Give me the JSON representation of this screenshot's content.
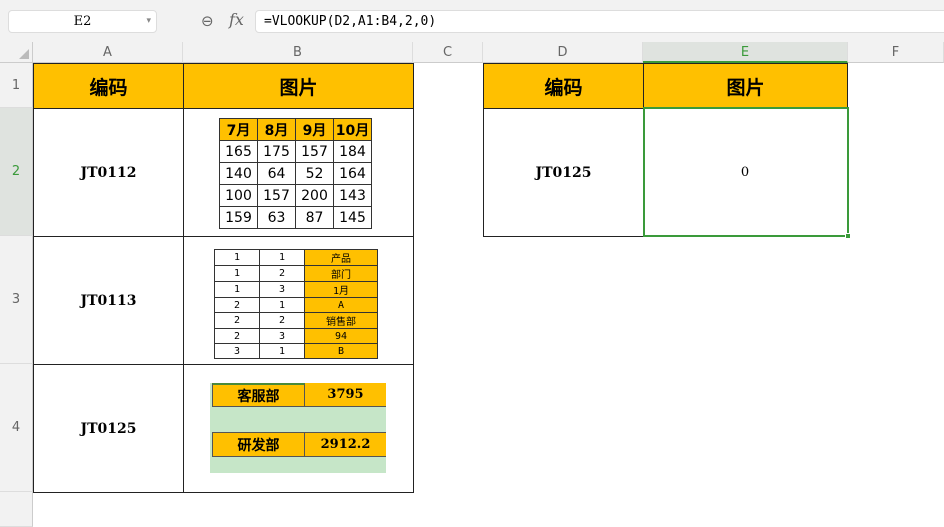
{
  "name_box": "E2",
  "formula": "=VLOOKUP(D2,A1:B4,2,0)",
  "fx_label": "fx",
  "columns": [
    "A",
    "B",
    "C",
    "D",
    "E",
    "F"
  ],
  "rows": [
    "1",
    "2",
    "3",
    "4"
  ],
  "sheet": {
    "a1": "编码",
    "b1": "图片",
    "a2": "JT0112",
    "a3": "JT0113",
    "a4": "JT0125",
    "d1": "编码",
    "e1": "图片",
    "d2": "JT0125",
    "e2": "0"
  },
  "pic1": {
    "headers": [
      "7月",
      "8月",
      "9月",
      "10月"
    ],
    "rows": [
      [
        "165",
        "175",
        "157",
        "184"
      ],
      [
        "140",
        "64",
        "52",
        "164"
      ],
      [
        "100",
        "157",
        "200",
        "143"
      ],
      [
        "159",
        "63",
        "87",
        "145"
      ]
    ]
  },
  "pic2": {
    "rows": [
      [
        "1",
        "1",
        "产品"
      ],
      [
        "1",
        "2",
        "部门"
      ],
      [
        "1",
        "3",
        "1月"
      ],
      [
        "2",
        "1",
        "A"
      ],
      [
        "2",
        "2",
        "销售部"
      ],
      [
        "2",
        "3",
        "94"
      ],
      [
        "3",
        "1",
        "B"
      ]
    ]
  },
  "pic3": {
    "r1": [
      "客服部",
      "3795"
    ],
    "r2": [
      "研发部",
      "2912.2"
    ]
  }
}
